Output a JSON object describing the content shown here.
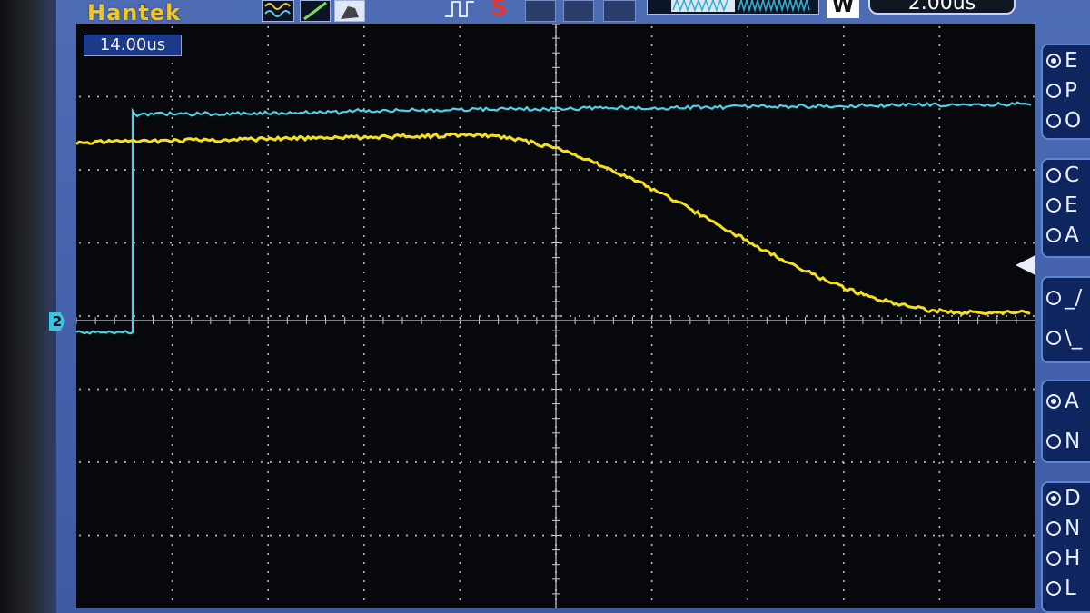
{
  "header": {
    "brand": "Hantek",
    "run_status": "S",
    "timebase": "2.00us",
    "acquire_mode": "W"
  },
  "scope": {
    "trigger_position": "14.00us",
    "ch2_label": "2"
  },
  "right_panel": {
    "groups": [
      {
        "items": [
          {
            "label": "E",
            "selected": true
          },
          {
            "label": "P",
            "selected": false
          },
          {
            "label": "O",
            "selected": false
          }
        ]
      },
      {
        "items": [
          {
            "label": "C",
            "selected": false
          },
          {
            "label": "E",
            "selected": false
          },
          {
            "label": "A",
            "selected": false
          }
        ]
      },
      {
        "items": [
          {
            "label": "_/",
            "selected": false
          },
          {
            "label": "\\_",
            "selected": false
          }
        ]
      },
      {
        "items": [
          {
            "label": "A",
            "selected": true
          },
          {
            "label": "N",
            "selected": false
          }
        ]
      },
      {
        "items": [
          {
            "label": "D",
            "selected": true
          },
          {
            "label": "N",
            "selected": false
          },
          {
            "label": "H",
            "selected": false
          },
          {
            "label": "L",
            "selected": false
          }
        ]
      }
    ]
  },
  "colors": {
    "ch1": "#f4e01c",
    "ch2": "#4fd2e6",
    "grid": "#c9ccd4",
    "accent": "#3d5aa3"
  },
  "icons": [
    "waveform-icon",
    "trigger-slope-icon",
    "probe-icon",
    "pulse-icon",
    "memory-bar-icon"
  ]
}
